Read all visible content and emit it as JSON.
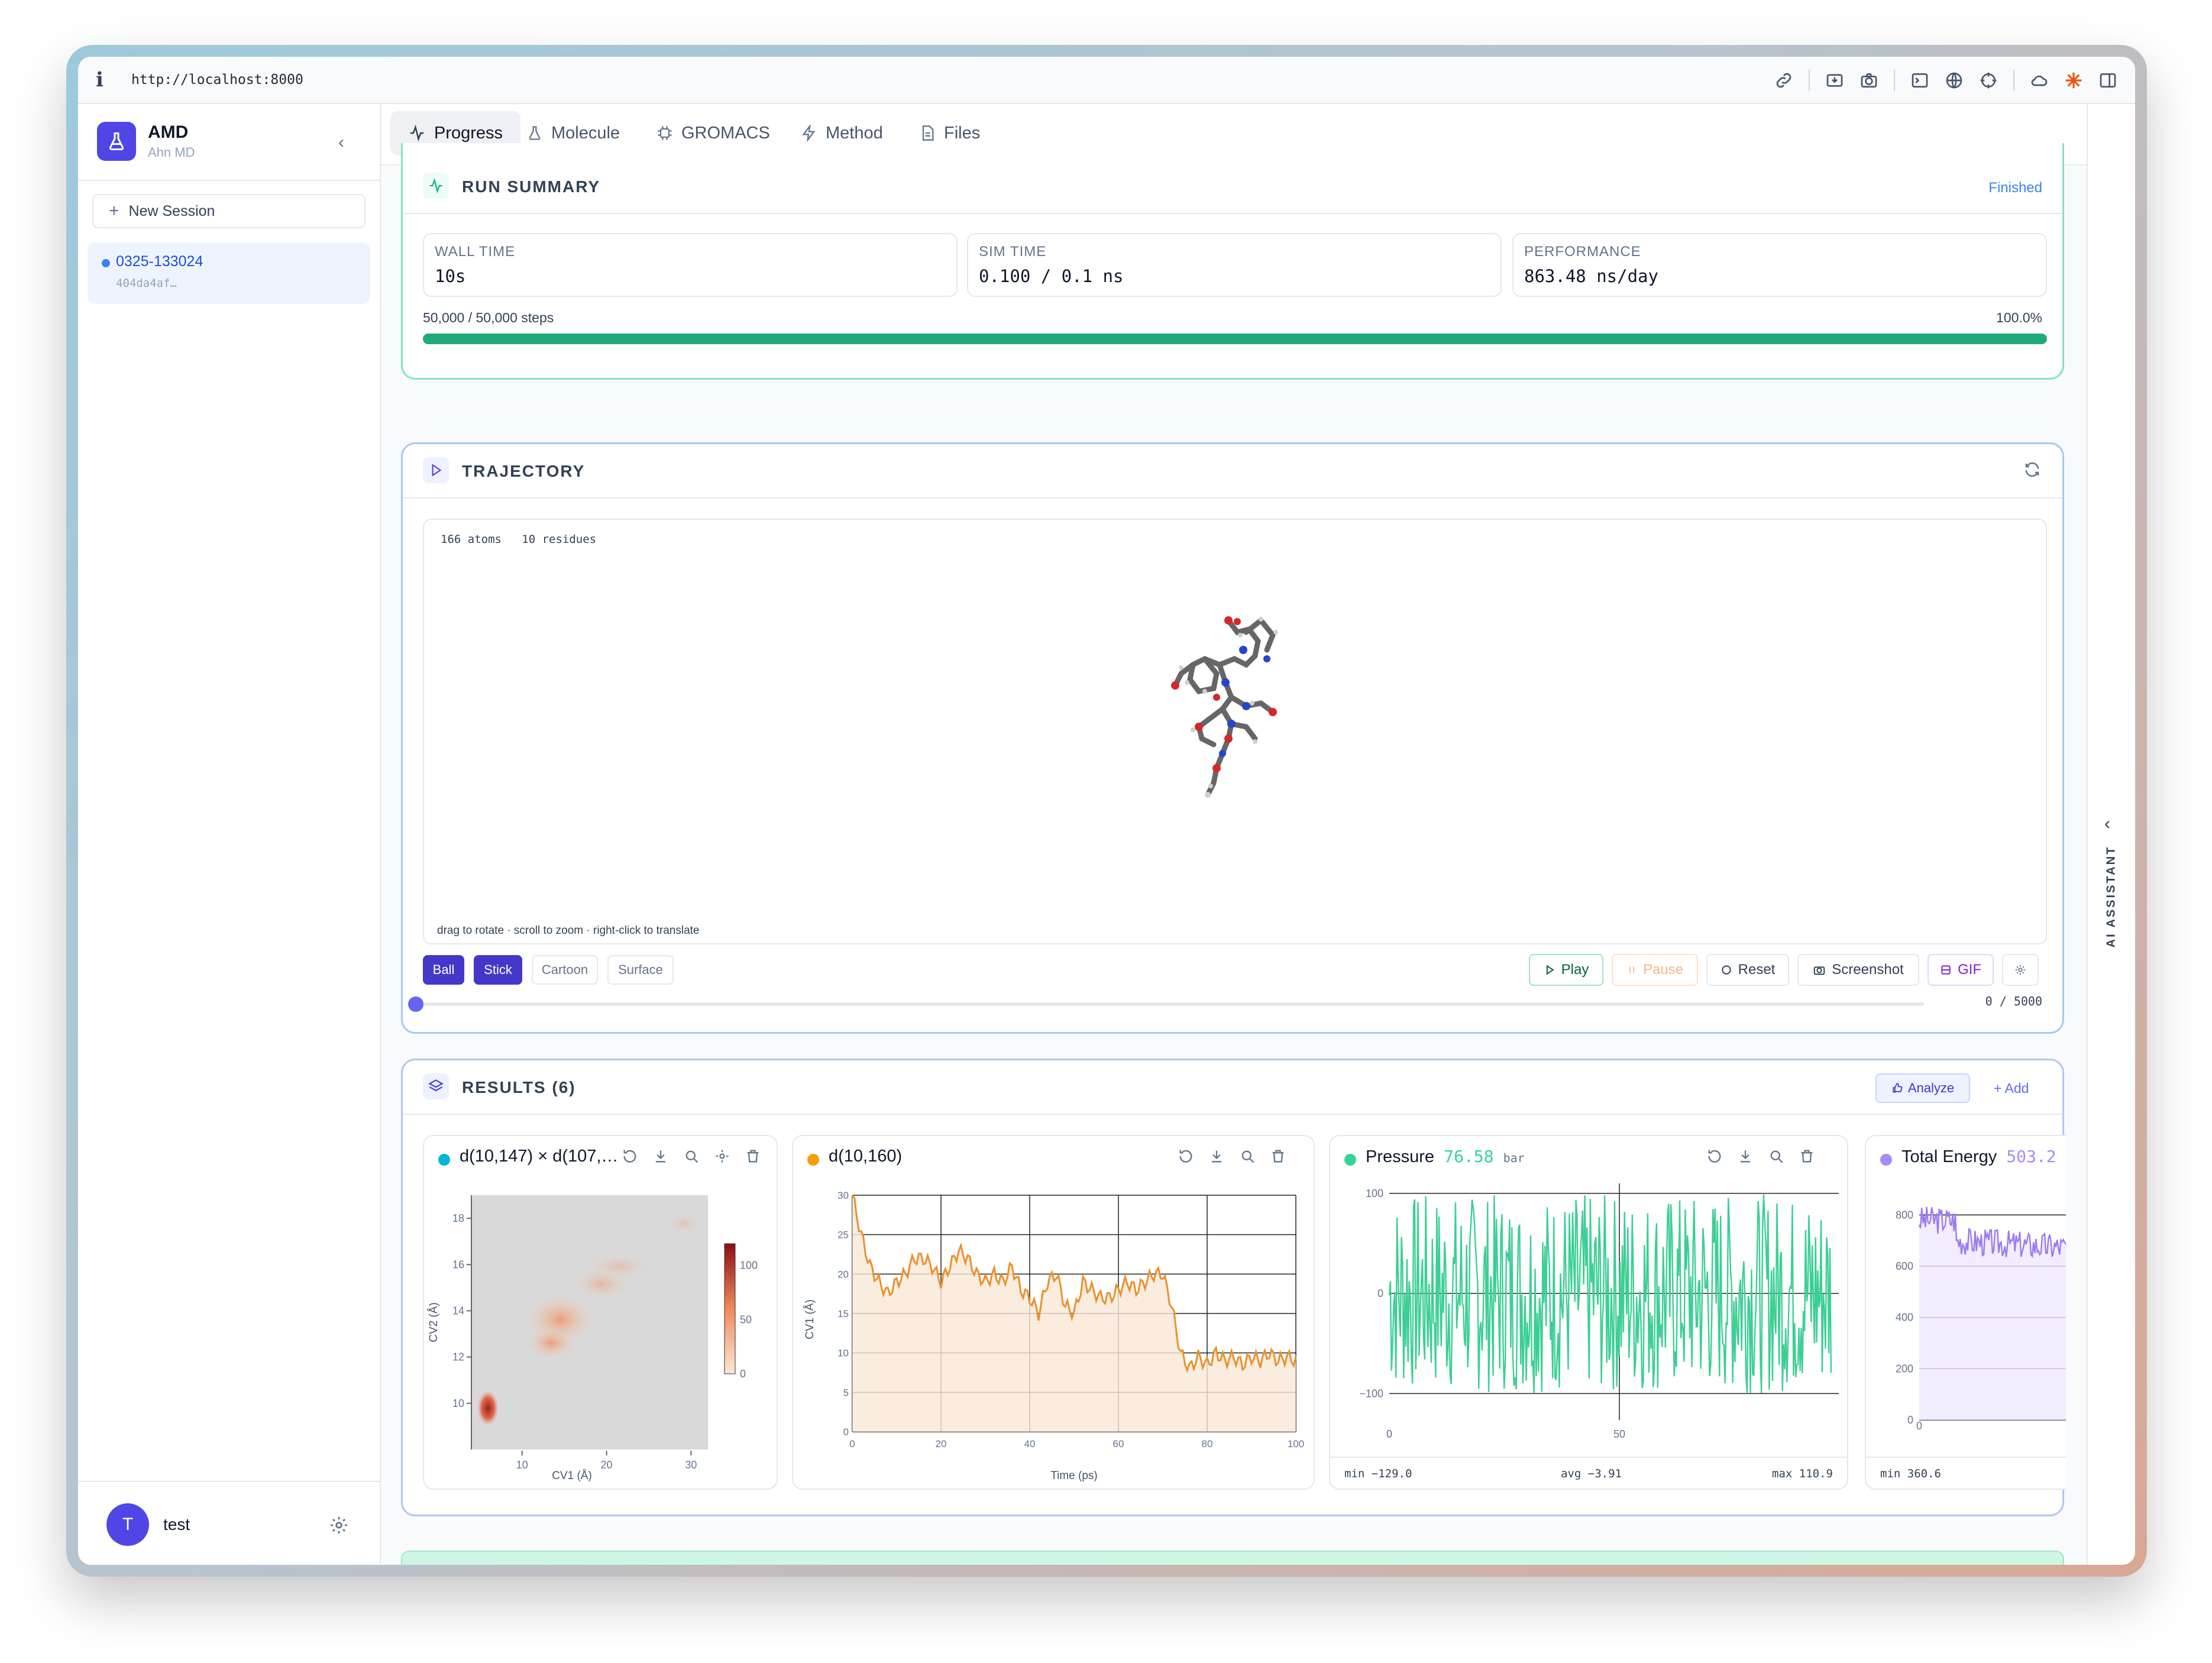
{
  "browser": {
    "url": "http://localhost:8000"
  },
  "sidebar": {
    "app_name": "AMD",
    "app_subtitle": "Ahn MD",
    "new_session_label": "New Session",
    "session": {
      "name": "0325-133024",
      "id": "404da4af…"
    },
    "user": {
      "initial": "T",
      "name": "test"
    }
  },
  "tabs": [
    {
      "label": "Progress",
      "icon": "activity-icon"
    },
    {
      "label": "Molecule",
      "icon": "flask-icon"
    },
    {
      "label": "GROMACS",
      "icon": "chip-icon"
    },
    {
      "label": "Method",
      "icon": "bolt-icon"
    },
    {
      "label": "Files",
      "icon": "file-icon"
    }
  ],
  "run_summary": {
    "title": "RUN SUMMARY",
    "status": "Finished",
    "wall_time_label": "WALL TIME",
    "wall_time": "10s",
    "sim_time_label": "SIM TIME",
    "sim_time": "0.100 / 0.1 ns",
    "performance_label": "PERFORMANCE",
    "performance": "863.48 ns/day",
    "steps": "50,000 / 50,000 steps",
    "percent": "100.0%",
    "progress": 1.0
  },
  "trajectory": {
    "title": "TRAJECTORY",
    "atoms": "166 atoms",
    "residues": "10 residues",
    "hint": "drag to rotate · scroll to zoom · right-click to translate",
    "styles": [
      "Ball",
      "Stick",
      "Cartoon",
      "Surface"
    ],
    "buttons": {
      "play": "Play",
      "pause": "Pause",
      "reset": "Reset",
      "screenshot": "Screenshot",
      "gif": "GIF"
    },
    "frame": "0 / 5000",
    "frame_value": 0
  },
  "results": {
    "title": "RESULTS (6)",
    "analyze_label": "Analyze",
    "add_label": "+ Add",
    "cards": [
      {
        "title": "d(10,147) × d(107,…",
        "color": "#06b6d4"
      },
      {
        "title": "d(10,160)",
        "color": "#f59e0b"
      },
      {
        "title": "Pressure",
        "value": "76.58",
        "unit": "bar",
        "color": "#34d399",
        "min": "min −129.0",
        "avg": "avg −3.91",
        "max": "max 110.9"
      },
      {
        "title": "Total Energy",
        "value": "503.2",
        "color": "#a78bfa",
        "min": "min 360.6"
      }
    ]
  },
  "chart_data": [
    {
      "type": "heatmap",
      "xlabel": "CV1 (Å)",
      "ylabel": "CV2 (Å)",
      "x_ticks": [
        10,
        20,
        30
      ],
      "y_ticks": [
        10,
        12,
        14,
        16,
        18
      ],
      "colorbar_ticks": [
        0,
        50,
        100
      ],
      "xlim": [
        4,
        32
      ],
      "ylim": [
        8,
        19
      ]
    },
    {
      "type": "area",
      "xlabel": "Time (ps)",
      "ylabel": "CV1 (Å)",
      "x_ticks": [
        0,
        20,
        40,
        60,
        80,
        100
      ],
      "y_ticks": [
        0,
        5,
        10,
        15,
        20,
        25,
        30
      ],
      "xlim": [
        0,
        100
      ],
      "ylim": [
        0,
        30
      ],
      "x": [
        0,
        2,
        4,
        6,
        8,
        10,
        12,
        14,
        16,
        18,
        20,
        22,
        24,
        26,
        28,
        30,
        32,
        34,
        36,
        38,
        40,
        42,
        44,
        46,
        48,
        50,
        52,
        54,
        56,
        58,
        60,
        62,
        64,
        66,
        68,
        70,
        72,
        74,
        76,
        78,
        80,
        82,
        84,
        86,
        88,
        90,
        92,
        94,
        96,
        98,
        100
      ],
      "y": [
        30,
        25,
        21,
        19,
        17.5,
        19,
        20,
        22,
        22,
        21,
        19,
        21,
        23,
        22,
        20,
        19,
        20,
        19,
        21,
        18,
        17,
        15,
        19,
        20,
        16,
        15,
        19,
        18,
        17,
        17,
        18,
        19,
        18,
        19,
        20,
        20,
        16,
        10,
        8,
        9.5,
        8.5,
        10,
        9,
        9.5,
        8.5,
        9.5,
        9,
        10,
        9,
        9.5,
        9
      ]
    },
    {
      "type": "line",
      "x_ticks": [
        0,
        50
      ],
      "y_ticks": [
        -100,
        0,
        100
      ],
      "xlim": [
        0,
        100
      ],
      "ylim": [
        -150,
        110
      ]
    },
    {
      "type": "line",
      "x_ticks": [
        0
      ],
      "y_ticks": [
        0,
        200,
        400,
        600,
        800
      ],
      "ylim": [
        0,
        900
      ]
    }
  ]
}
